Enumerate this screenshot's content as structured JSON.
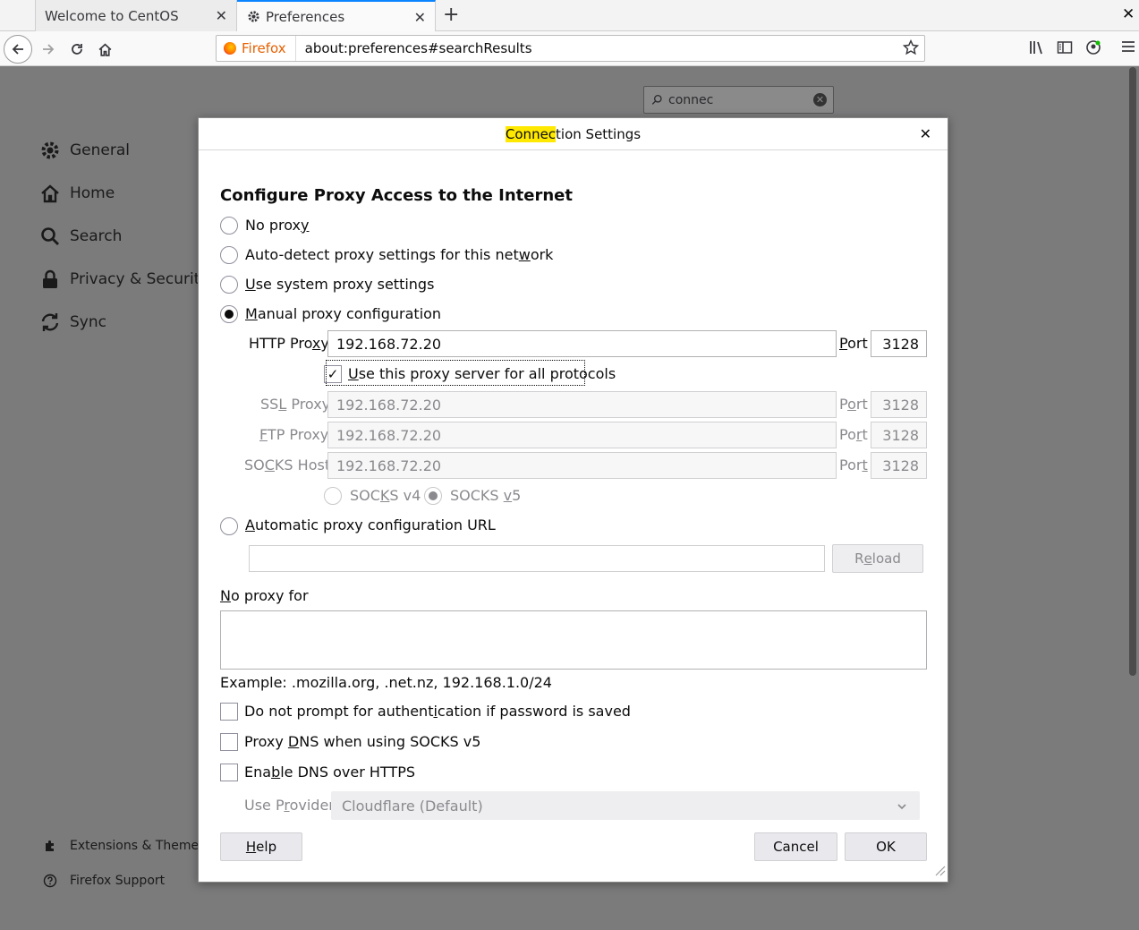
{
  "tabs": [
    {
      "label": "Welcome to CentOS"
    },
    {
      "label": "Preferences"
    }
  ],
  "urlbar": {
    "identity": "Firefox",
    "url": "about:preferences#searchResults"
  },
  "prefs": {
    "search_value": "connec",
    "categories": [
      "General",
      "Home",
      "Search",
      "Privacy & Security",
      "Sync"
    ],
    "footer": [
      "Extensions & Themes",
      "Firefox Support"
    ]
  },
  "dialog": {
    "title_highlight": "Connec",
    "title_rest": "tion Settings",
    "heading": "Configure Proxy Access to the Internet",
    "options": {
      "no_proxy": {
        "pre": "No prox",
        "key": "y",
        "post": ""
      },
      "auto_detect": {
        "pre": "Auto-detect proxy settings for this net",
        "key": "w",
        "post": "ork"
      },
      "system": {
        "pre": "",
        "key": "U",
        "post": "se system proxy settings"
      },
      "manual": {
        "pre": "",
        "key": "M",
        "post": "anual proxy configuration"
      },
      "auto_url": {
        "pre": "",
        "key": "A",
        "post": "utomatic proxy configuration URL"
      }
    },
    "http": {
      "pre": "HTTP Pro",
      "key": "x",
      "post": "y",
      "value": "192.168.72.20",
      "port_label": {
        "key": "P",
        "post": "ort"
      },
      "port": "3128"
    },
    "all_protocols": {
      "key": "U",
      "post": "se this proxy server for all protocols"
    },
    "ssl": {
      "pre": "SS",
      "key": "L",
      "post": " Proxy",
      "value": "192.168.72.20",
      "port_label": {
        "pre": "P",
        "key": "o",
        "post": "rt"
      },
      "port": "3128"
    },
    "ftp": {
      "pre": "",
      "key": "F",
      "post": "TP Proxy",
      "value": "192.168.72.20",
      "port_label": {
        "pre": "Po",
        "key": "r",
        "post": "t"
      },
      "port": "3128"
    },
    "socks": {
      "pre": "SO",
      "key": "C",
      "post": "KS Host",
      "value": "192.168.72.20",
      "port_label": {
        "pre": "Por",
        "key": "t",
        "post": ""
      },
      "port": "3128"
    },
    "socks_v4": {
      "pre": "SOC",
      "key": "K",
      "post": "S v4"
    },
    "socks_v5": {
      "pre": "SOCKS ",
      "key": "v",
      "post": "5"
    },
    "reload": {
      "pre": "R",
      "key": "e",
      "post": "load"
    },
    "no_proxy_for": {
      "key": "N",
      "post": "o proxy for"
    },
    "example": "Example: .mozilla.org, .net.nz, 192.168.1.0/24",
    "no_prompt": {
      "pre": "Do not prompt for authent",
      "key": "i",
      "post": "cation if password is saved"
    },
    "proxy_dns": {
      "pre": "Proxy ",
      "key": "D",
      "post": "NS when using SOCKS v5"
    },
    "doh": {
      "pre": "Ena",
      "key": "b",
      "post": "le DNS over HTTPS"
    },
    "provider_label": {
      "pre": "Use P",
      "key": "r",
      "post": "ovider"
    },
    "provider_value": "Cloudflare (Default)",
    "help": {
      "key": "H",
      "post": "elp"
    },
    "cancel": "Cancel",
    "ok": "OK"
  }
}
